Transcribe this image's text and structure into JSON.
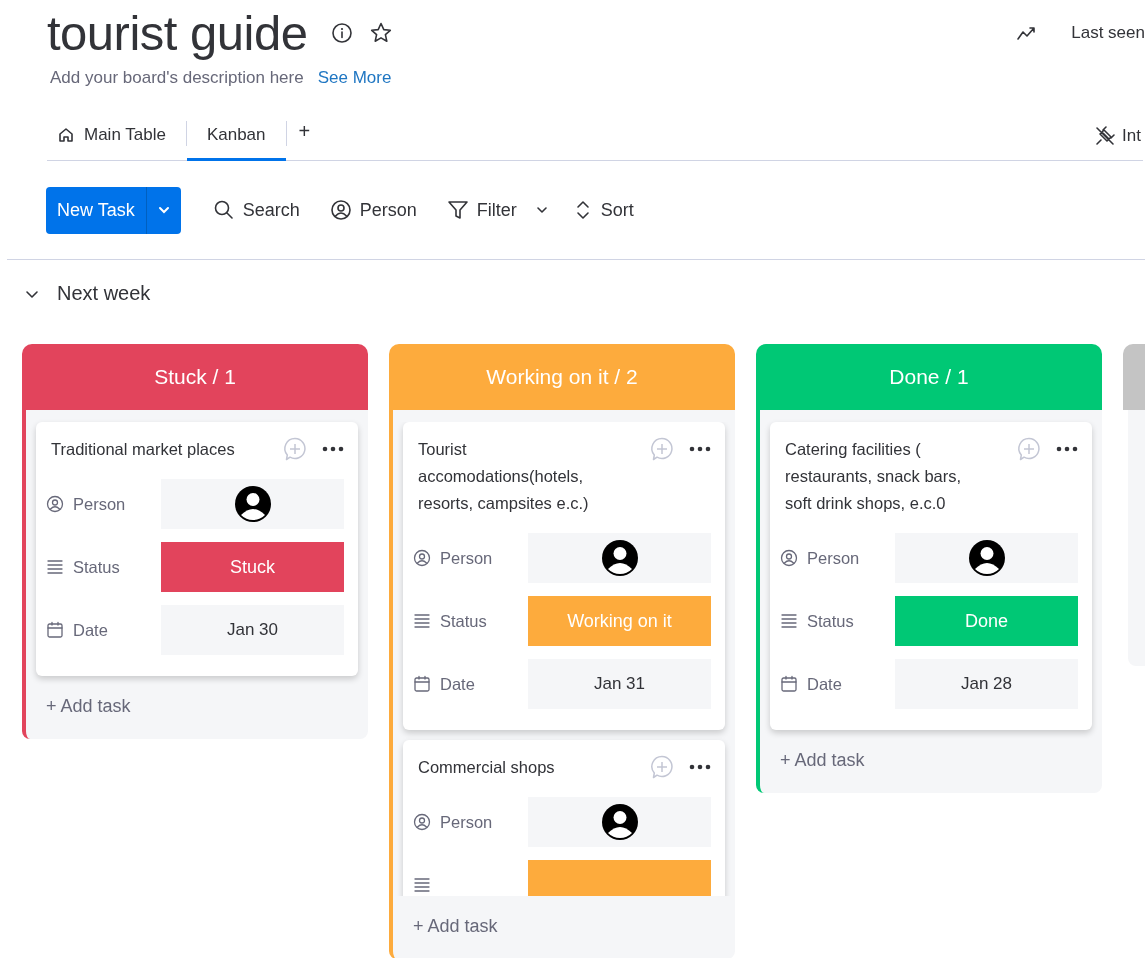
{
  "board": {
    "title": "tourist guide",
    "description": "Add your board's description here",
    "see_more": "See More",
    "last_seen": "Last seen",
    "integrate": "Int"
  },
  "tabs": [
    {
      "label": "Main Table",
      "kind": "table",
      "selected": false
    },
    {
      "label": "Kanban",
      "kind": "kanban",
      "selected": true
    }
  ],
  "add_tab": "+",
  "toolbar": {
    "new_task": "New Task",
    "items": [
      {
        "kind": "search",
        "label": "Search"
      },
      {
        "kind": "person",
        "label": "Person"
      },
      {
        "kind": "filter",
        "label": "Filter"
      },
      {
        "kind": "sort",
        "label": "Sort"
      }
    ]
  },
  "group": {
    "title": "Next week",
    "expanded": true
  },
  "columns": [
    {
      "title": "Stuck / 1",
      "color": "#e2445c",
      "add_task": "+ Add task",
      "cards": [
        {
          "title": "Traditional market places",
          "fields": [
            {
              "kind": "person",
              "label": "Person"
            },
            {
              "kind": "status",
              "label": "Status",
              "value": "Stuck",
              "color": "#e2445c"
            },
            {
              "kind": "date",
              "label": "Date",
              "value": "Jan 30"
            }
          ]
        }
      ]
    },
    {
      "title": "Working on it / 2",
      "color": "#fdab3d",
      "add_task": "+ Add task",
      "clipped": true,
      "cards": [
        {
          "title": "Tourist accomodations(hotels, resorts, campsites e.c.)",
          "fields": [
            {
              "kind": "person",
              "label": "Person"
            },
            {
              "kind": "status",
              "label": "Status",
              "value": "Working on it",
              "color": "#fdab3d"
            },
            {
              "kind": "date",
              "label": "Date",
              "value": "Jan 31"
            }
          ]
        },
        {
          "title": "Commercial shops",
          "fields": [
            {
              "kind": "person",
              "label": "Person"
            },
            {
              "kind": "status",
              "color": "#fdab3d"
            }
          ]
        }
      ]
    },
    {
      "title": "Done / 1",
      "color": "#00c875",
      "add_task": "+ Add task",
      "cards": [
        {
          "title": "Catering facilities ( restaurants, snack bars, soft drink shops, e.c.0",
          "fields": [
            {
              "kind": "person",
              "label": "Person"
            },
            {
              "kind": "status",
              "label": "Status",
              "value": "Done",
              "color": "#00c875"
            },
            {
              "kind": "date",
              "label": "Date",
              "value": "Jan 28"
            }
          ]
        }
      ]
    },
    {
      "color": "#c4c4c4"
    }
  ]
}
